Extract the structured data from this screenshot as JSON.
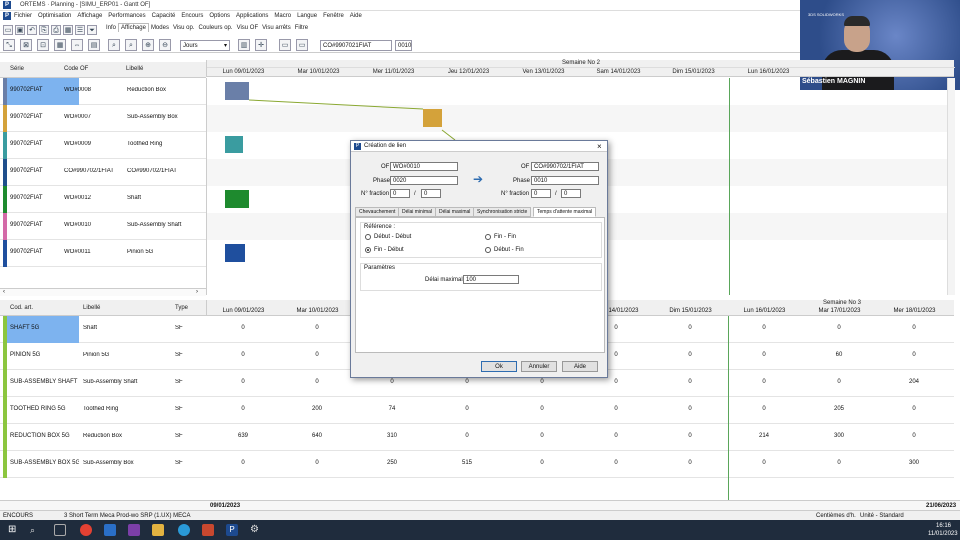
{
  "app": {
    "title": "ORTEMS · Planning - [SIMU_ERP01 - Gantt OF]",
    "logo_letter": "P",
    "menu": [
      "Fichier",
      "Optimisation",
      "Affichage",
      "Performances",
      "Capacité",
      "Encours",
      "Options",
      "Applications",
      "Macro",
      "Langue",
      "Fenêtre",
      "Aide"
    ]
  },
  "ribbon": {
    "tabs": [
      "Info",
      "Affichage",
      "Modes",
      "Visu op.",
      "Couleurs op.",
      "Visu OF",
      "Visu arrêts",
      "Filtre"
    ],
    "active": "Affichage"
  },
  "toolbar": {
    "scale_select": "Jours",
    "of_field": "CO#9907021FIAT",
    "of_suffix": "0010"
  },
  "video": {
    "name": "Sébastien MAGNIN",
    "logo_text": "3DS SOLIDWORKS"
  },
  "top_table": {
    "headers": {
      "serie": "Série",
      "code": "Code OF",
      "label": "Libellé"
    },
    "rows": [
      {
        "serie": "990702FIAT",
        "code": "WO#0008",
        "label": "Reduction Box",
        "color": "#6a7fa8",
        "selected": true
      },
      {
        "serie": "990702FIAT",
        "code": "WO#0007",
        "label": "Sub-Assembly Box",
        "color": "#d4a23a",
        "selected": false
      },
      {
        "serie": "990702FIAT",
        "code": "WO#0009",
        "label": "Toothed Ring",
        "color": "#3a9ca0",
        "selected": false
      },
      {
        "serie": "990702FIAT",
        "code": "CO#990702/1FIAT",
        "label": "CO#990702/1FIAT",
        "color": "#1f4f8c",
        "selected": false
      },
      {
        "serie": "990702FIAT",
        "code": "WO#0012",
        "label": "Shaft",
        "color": "#1e8a2e",
        "selected": false
      },
      {
        "serie": "990702FIAT",
        "code": "WO#0010",
        "label": "Sub-Assembly Shaft",
        "color": "#d46aa8",
        "selected": false
      },
      {
        "serie": "990702FIAT",
        "code": "WO#0011",
        "label": "Pinion 5G",
        "color": "#1f4f9e",
        "selected": false
      }
    ]
  },
  "gantt": {
    "week_label": "Semaine No 2",
    "days": [
      "Lun 09/01/2023",
      "Mar 10/01/2023",
      "Mer 11/01/2023",
      "Jeu 12/01/2023",
      "Ven 13/01/2023",
      "Sam 14/01/2023",
      "Dim 15/01/2023",
      "Lun 16/01/2023"
    ]
  },
  "bottom_table": {
    "headers": {
      "code": "Cod. art.",
      "label": "Libellé",
      "type": "Type"
    },
    "week_label": "Semaine No 3",
    "days": [
      "Lun 09/01/2023",
      "Mar 10/01/2023",
      "Mer 11/01/2023",
      "Jeu 12/01/2023",
      "Ven 13/01/2023",
      "Sam 14/01/2023",
      "Dim 15/01/2023",
      "Lun 16/01/2023",
      "Mar 17/01/2023",
      "Mer 18/01/2023"
    ],
    "rows": [
      {
        "code": "SHAFT 5G",
        "label": "Shaft",
        "type": "SF",
        "values": [
          "0",
          "0",
          "",
          "",
          "",
          "0",
          "0",
          "0",
          "0",
          "0"
        ],
        "selected": true
      },
      {
        "code": "PINION 5G",
        "label": "Pinion 5G",
        "type": "SF",
        "values": [
          "0",
          "0",
          "",
          "",
          "",
          "0",
          "0",
          "0",
          "60",
          "0"
        ],
        "selected": false
      },
      {
        "code": "SUB-ASSEMBLY SHAFT 5",
        "label": "Sub-Assembly Shaft",
        "type": "SF",
        "values": [
          "0",
          "0",
          "0",
          "0",
          "0",
          "0",
          "0",
          "0",
          "0",
          "204"
        ],
        "selected": false
      },
      {
        "code": "TOOTHED RING 5G",
        "label": "Toothed Ring",
        "type": "SF",
        "values": [
          "0",
          "200",
          "74",
          "0",
          "0",
          "0",
          "0",
          "0",
          "205",
          "0"
        ],
        "selected": false
      },
      {
        "code": "REDUCTION BOX 5G",
        "label": "Reduction Box",
        "type": "SF",
        "values": [
          "639",
          "640",
          "310",
          "0",
          "0",
          "0",
          "0",
          "214",
          "300",
          "0"
        ],
        "selected": false
      },
      {
        "code": "SUB-ASSEMBLY BOX 5G",
        "label": "Sub-Assembly Box",
        "type": "SF",
        "values": [
          "0",
          "0",
          "250",
          "515",
          "0",
          "0",
          "0",
          "0",
          "0",
          "300"
        ],
        "selected": false
      }
    ],
    "footer_left": "09/01/2023",
    "footer_right": "21/06/2023"
  },
  "dialog": {
    "title": "Création de lien",
    "left": {
      "of_label": "OF",
      "of": "WO#0010",
      "phase_label": "Phase",
      "phase": "0020",
      "fraction_label": "N° fraction",
      "frac_a": "0",
      "frac_b": "0"
    },
    "right": {
      "of_label": "OF",
      "of": "CO#990702/1FIAT",
      "phase_label": "Phase",
      "phase": "0010",
      "fraction_label": "N° fraction",
      "frac_a": "0",
      "frac_b": "0"
    },
    "slash": "/",
    "arrow": "➔",
    "tabs": [
      "Chevauchement",
      "Délai minimal",
      "Délai maximal",
      "Synchronisation stricte",
      "Temps d'attente maximal"
    ],
    "active_tab": "Temps d'attente maximal",
    "reference_label": "Référence :",
    "radios": [
      "Début - Début",
      "Fin - Fin",
      "Fin - Début",
      "Début - Fin"
    ],
    "selected_radio": "Fin - Début",
    "params_label": "Paramètres",
    "delay_label": "Délai maximal :",
    "delay_value": "100",
    "buttons": {
      "ok": "Ok",
      "cancel": "Annuler",
      "help": "Aide"
    }
  },
  "status": {
    "left": "ENCOURS",
    "middle": "3 Short Term Meca Prod-wo SRP (1.UX) MECA",
    "right1": "Centièmes d'h.",
    "right2": "Unité - Standard"
  },
  "taskbar": {
    "time": "16:16",
    "date": "11/01/2023"
  }
}
